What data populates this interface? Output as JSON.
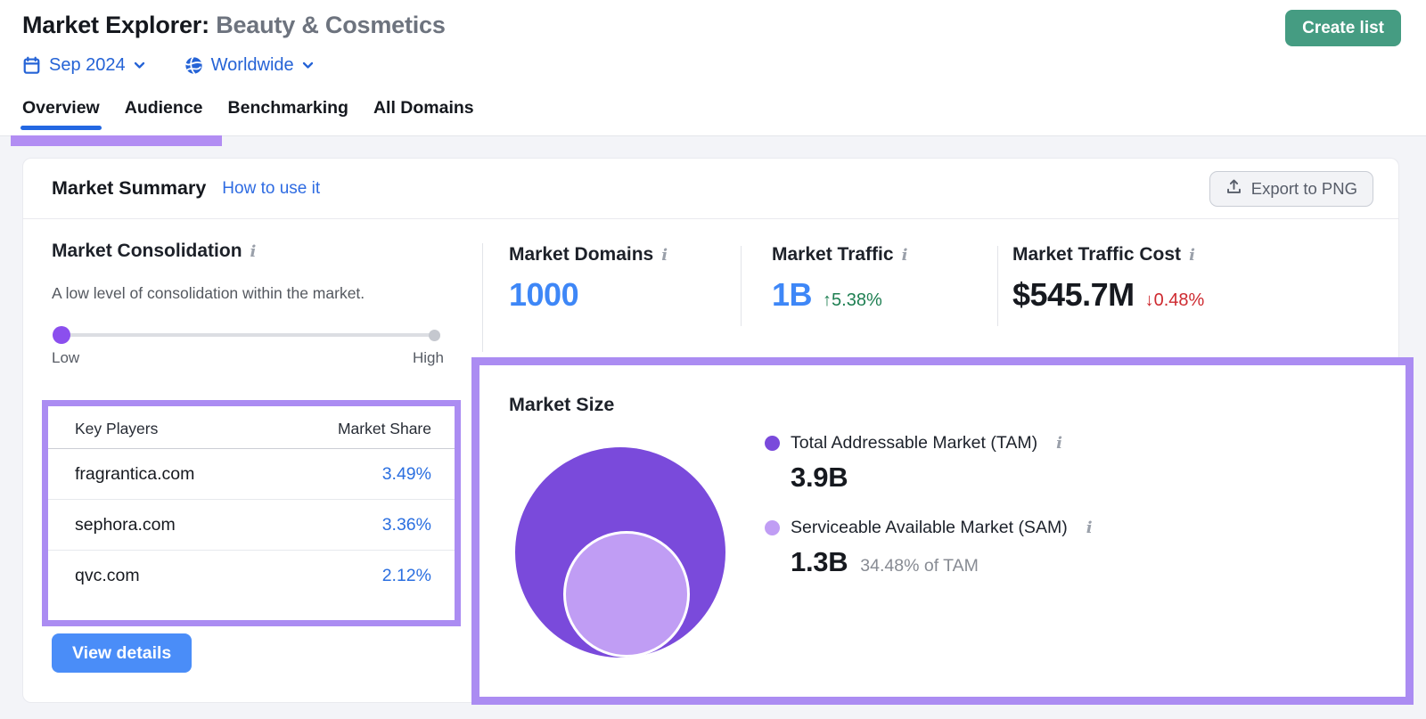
{
  "page": {
    "title_primary": "Market Explorer:",
    "title_secondary": "Beauty & Cosmetics",
    "create_list_label": "Create list",
    "date_selector": "Sep 2024",
    "region_selector": "Worldwide",
    "tabs": {
      "overview": "Overview",
      "audience": "Audience",
      "benchmarking": "Benchmarking",
      "all_domains": "All Domains"
    },
    "active_tab": "Overview"
  },
  "summary": {
    "title": "Market Summary",
    "howto_link": "How to use it",
    "export_label": "Export to PNG"
  },
  "consolidation": {
    "title": "Market Consolidation",
    "description": "A low level of consolidation within the market.",
    "low_label": "Low",
    "high_label": "High",
    "level": "low"
  },
  "key_players": {
    "col_players": "Key Players",
    "col_share": "Market Share",
    "rows": [
      {
        "domain": "fragrantica.com",
        "share": "3.49%"
      },
      {
        "domain": "sephora.com",
        "share": "3.36%"
      },
      {
        "domain": "qvc.com",
        "share": "2.12%"
      }
    ],
    "view_details_label": "View details"
  },
  "metrics": {
    "domains": {
      "label": "Market Domains",
      "value": "1000"
    },
    "traffic": {
      "label": "Market Traffic",
      "value": "1B",
      "change": "↑5.38%",
      "direction": "up"
    },
    "cost": {
      "label": "Market Traffic Cost",
      "value": "$545.7M",
      "change": "↓0.48%",
      "direction": "down"
    }
  },
  "market_size": {
    "title": "Market Size",
    "tam": {
      "label": "Total Addressable Market (TAM)",
      "value": "3.9B"
    },
    "sam": {
      "label": "Serviceable Available Market (SAM)",
      "value": "1.3B",
      "note": "34.48% of TAM"
    }
  },
  "icons": {
    "info": "i"
  },
  "colors": {
    "accent_blue": "#3e87f7",
    "link_blue": "#2e6be2",
    "tab_underline": "#2367e2",
    "positive_green": "#1e7f52",
    "negative_red": "#ce2a30",
    "tam_purple": "#7a4adb",
    "sam_light_purple": "#c09df4",
    "annotation_purple": "#ab8cf2",
    "create_list_green": "#459c82",
    "view_details_blue": "#4a8df8"
  }
}
